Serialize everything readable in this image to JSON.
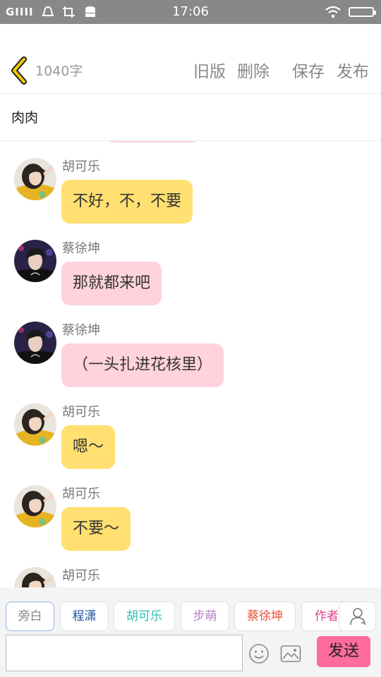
{
  "status_bar": {
    "signal": "GIIII",
    "time": "17:06"
  },
  "header": {
    "word_count": "1040字",
    "actions": {
      "old_version": "旧版",
      "delete": "删除",
      "save": "保存",
      "publish": "发布"
    }
  },
  "chat": {
    "title": "肉肉"
  },
  "messages": [
    {
      "sender": "胡可乐",
      "text": "不好，不，不要",
      "bubble": "yellow",
      "avatar": "avatar-girl"
    },
    {
      "sender": "蔡徐坤",
      "text": "那就都来吧",
      "bubble": "pink",
      "avatar": "avatar-boy"
    },
    {
      "sender": "蔡徐坤",
      "text": "（一头扎进花核里）",
      "bubble": "pink",
      "avatar": "avatar-boy"
    },
    {
      "sender": "胡可乐",
      "text": "嗯～",
      "bubble": "yellow",
      "avatar": "avatar-girl"
    },
    {
      "sender": "胡可乐",
      "text": "不要～",
      "bubble": "yellow",
      "avatar": "avatar-girl"
    },
    {
      "sender": "胡可乐",
      "text": "",
      "bubble": "none",
      "avatar": "avatar-girl"
    }
  ],
  "characters": [
    {
      "name": "旁白",
      "color": "#888888"
    },
    {
      "name": "程潇",
      "color": "#1f4e9c"
    },
    {
      "name": "胡可乐",
      "color": "#2bbfae"
    },
    {
      "name": "步萌",
      "color": "#b77bc9"
    },
    {
      "name": "蔡徐坤",
      "color": "#e0533a"
    },
    {
      "name": "作者",
      "color": "#e0408a"
    }
  ],
  "input": {
    "placeholder": "",
    "send_label": "发送"
  },
  "colors": {
    "accent_yellow": "#ffe070",
    "accent_pink": "#ffd2dc",
    "send": "#ff6b9a",
    "status_bar": "#888888"
  },
  "icons": [
    "back-chevron-icon",
    "emoji-icon",
    "image-icon",
    "person-icon",
    "wifi-icon",
    "battery-icon"
  ]
}
